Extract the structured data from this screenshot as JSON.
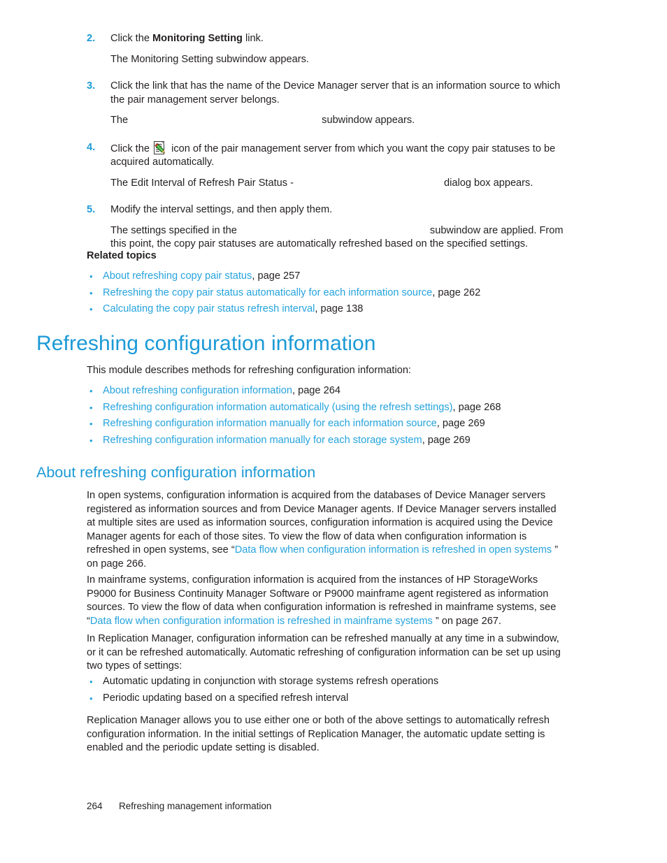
{
  "colors": {
    "accent_blue": "#1b9ad6",
    "link_blue": "#25a3dd",
    "body_text": "#231f20"
  },
  "steps": [
    {
      "number": "2.",
      "text_before_bold": "Click the ",
      "bold": "Monitoring Setting",
      "text_after_bold": " link.",
      "result": "The Monitoring Setting subwindow appears."
    },
    {
      "number": "3.",
      "text": "Click the link that has the name of the Device Manager server that is an information source to which the pair management server belongs.",
      "result_prefix": "The",
      "result_blank": "",
      "result_suffix": "subwindow appears."
    },
    {
      "number": "4.",
      "text_before_icon": "Click the ",
      "icon": "edit-document-icon",
      "text_after_icon": " icon of the pair management server from which you want the copy pair statuses to be acquired automatically.",
      "result_prefix": "The Edit Interval of Refresh Pair Status -",
      "result_blank": "",
      "result_suffix": "dialog box appears."
    },
    {
      "number": "5.",
      "text": "Modify the interval settings, and then apply them.",
      "result_prefix": "The settings specified in the",
      "result_blank": "",
      "result_suffix": "subwindow are applied. From this point, the copy pair statuses are automatically refreshed based on the specified settings."
    }
  ],
  "related_topics": {
    "heading": "Related topics",
    "items": [
      {
        "link": "About refreshing copy pair status",
        "page": ", page 257"
      },
      {
        "link": "Refreshing the copy pair status automatically for each information source",
        "page": ", page 262"
      },
      {
        "link": "Calculating the copy pair status refresh interval",
        "page": ", page 138"
      }
    ]
  },
  "section": {
    "h1": "Refreshing configuration information",
    "intro": "This module describes methods for refreshing configuration information:",
    "module_items": [
      {
        "link": "About refreshing configuration information",
        "page": ", page 264"
      },
      {
        "link": "Refreshing configuration information automatically (using the refresh settings)",
        "page": ", page 268"
      },
      {
        "link": "Refreshing configuration information manually for each information source",
        "page": ", page 269"
      },
      {
        "link": "Refreshing configuration information manually for each storage system",
        "page": ", page 269"
      }
    ],
    "h2": "About refreshing configuration information",
    "para_open_part1": "In open systems, configuration information is acquired from the databases of Device Manager servers registered as information sources and from Device Manager agents. If Device Manager servers installed at multiple sites are used as information sources, configuration information is acquired using the Device Manager agents for each of those sites. To view the flow of data when configuration information is refreshed in open systems, see “",
    "para_open_link": "Data flow when configuration information is refreshed in open systems ",
    "para_open_part2": " ” on page 266.",
    "para_mainframe_part1": "In mainframe systems, configuration information is acquired from the instances of HP StorageWorks P9000 for Business Continuity Manager Software or P9000 mainframe agent registered as information sources. To view the flow of data when configuration information is refreshed in mainframe systems, see “",
    "para_mainframe_link": "Data flow when configuration information is refreshed in mainframe systems",
    "para_mainframe_part2": " ” on page 267.",
    "para_replmgr": "In Replication Manager, configuration information can be refreshed manually at any time in a subwindow, or it can be refreshed automatically. Automatic refreshing of configuration information can be set up using two types of settings:",
    "settings_items": [
      "Automatic updating in conjunction with storage systems refresh operations",
      "Periodic updating based on a specified refresh interval"
    ],
    "para_allows": "Replication Manager allows you to use either one or both of the above settings to automatically refresh configuration information. In the initial settings of Replication Manager, the automatic update setting is enabled and the periodic update setting is disabled."
  },
  "footer": {
    "page_number": "264",
    "chapter": "Refreshing management information"
  }
}
